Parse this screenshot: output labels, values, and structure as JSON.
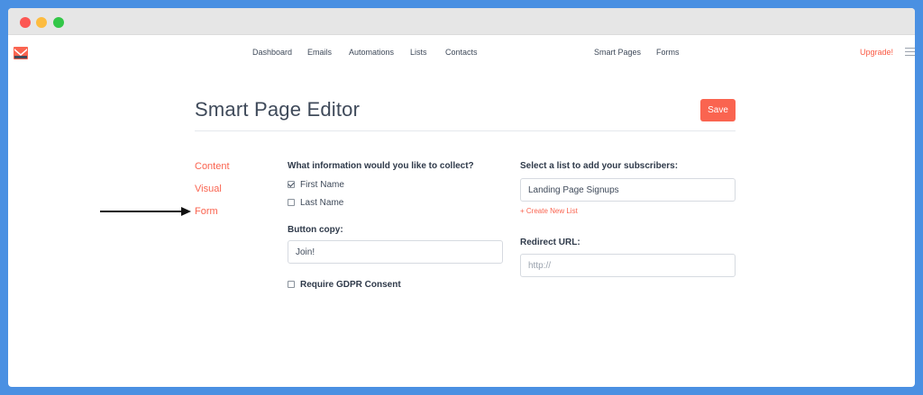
{
  "nav": {
    "links": [
      "Dashboard",
      "Emails",
      "Automations",
      "Lists",
      "Contacts"
    ],
    "right_links": [
      "Smart Pages",
      "Forms"
    ],
    "upgrade": "Upgrade!"
  },
  "page": {
    "title": "Smart Page Editor",
    "save_label": "Save"
  },
  "sidebar": {
    "items": [
      "Content",
      "Visual",
      "Form"
    ],
    "active": "Form"
  },
  "form": {
    "collect_heading": "What information would you like to collect?",
    "fields": [
      {
        "label": "First Name",
        "checked": true
      },
      {
        "label": "Last Name",
        "checked": false
      }
    ],
    "button_copy_heading": "Button copy:",
    "button_copy_value": "Join!",
    "gdpr_label": "Require GDPR Consent",
    "gdpr_checked": false,
    "list_heading": "Select a list to add your subscribers:",
    "list_value": "Landing Page Signups",
    "create_list_link": "+ Create New List",
    "redirect_heading": "Redirect URL:",
    "redirect_placeholder": "http://"
  },
  "colors": {
    "accent": "#fa6450",
    "frame": "#4a90e2",
    "text": "#3f4a5a"
  }
}
